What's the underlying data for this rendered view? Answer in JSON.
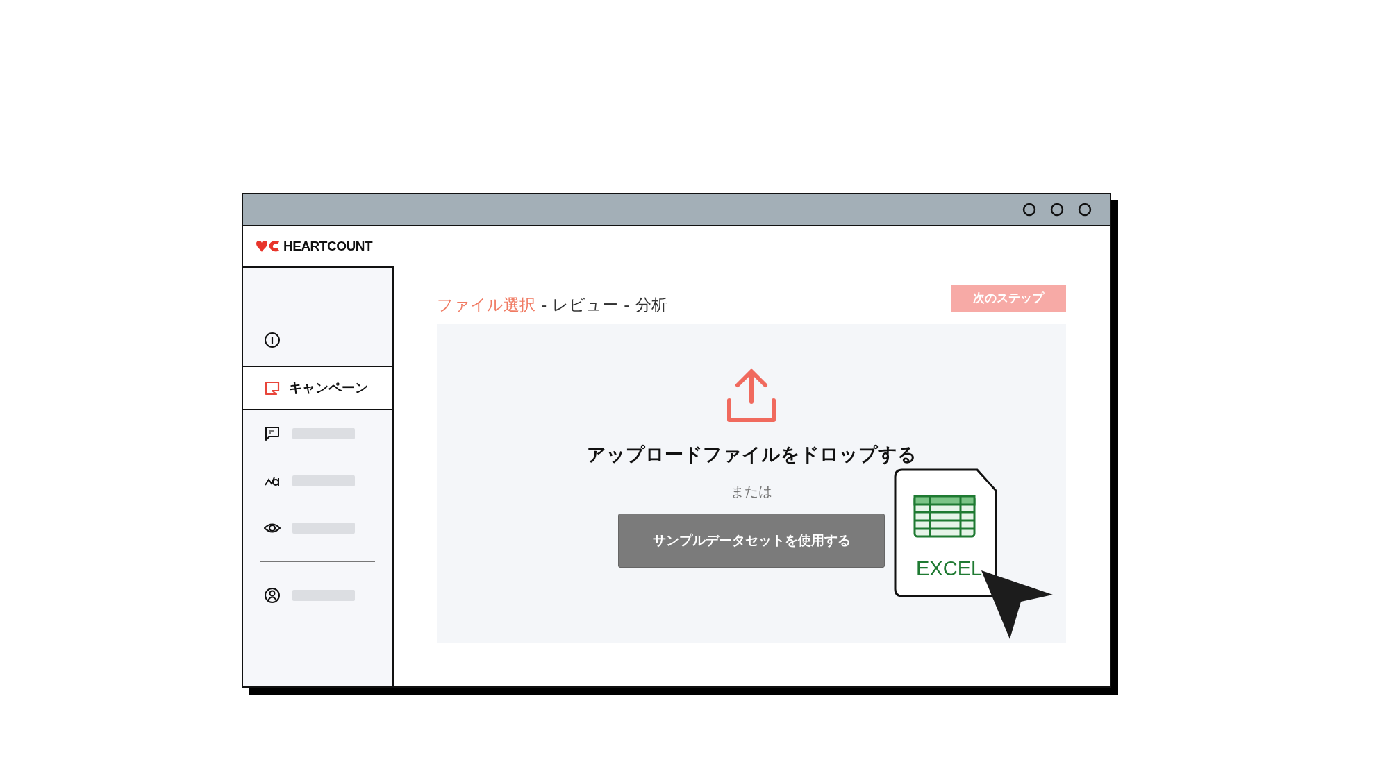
{
  "header": {
    "logo_text": "HEARTCOUNT"
  },
  "sidebar": {
    "items": [
      {
        "kind": "top",
        "selected": false
      },
      {
        "kind": "link",
        "label": "キャンペーン",
        "selected": true
      },
      {
        "kind": "link",
        "selected": false
      },
      {
        "kind": "link",
        "selected": false
      },
      {
        "kind": "link",
        "selected": false
      },
      {
        "kind": "divider"
      },
      {
        "kind": "link",
        "selected": false
      }
    ]
  },
  "steps": [
    {
      "label": "ファイル選択",
      "selected": true
    },
    {
      "label": "レビュー",
      "selected": false
    },
    {
      "label": "分析",
      "selected": false
    }
  ],
  "step_separator": "-",
  "next_button": {
    "label": "次のステップ",
    "disabled": true
  },
  "dropzone": {
    "title": "アップロードファイルをドロップする",
    "or_text": "または",
    "sample_button": "サンプルデータセットを使用する",
    "file_label": "EXCEL"
  }
}
